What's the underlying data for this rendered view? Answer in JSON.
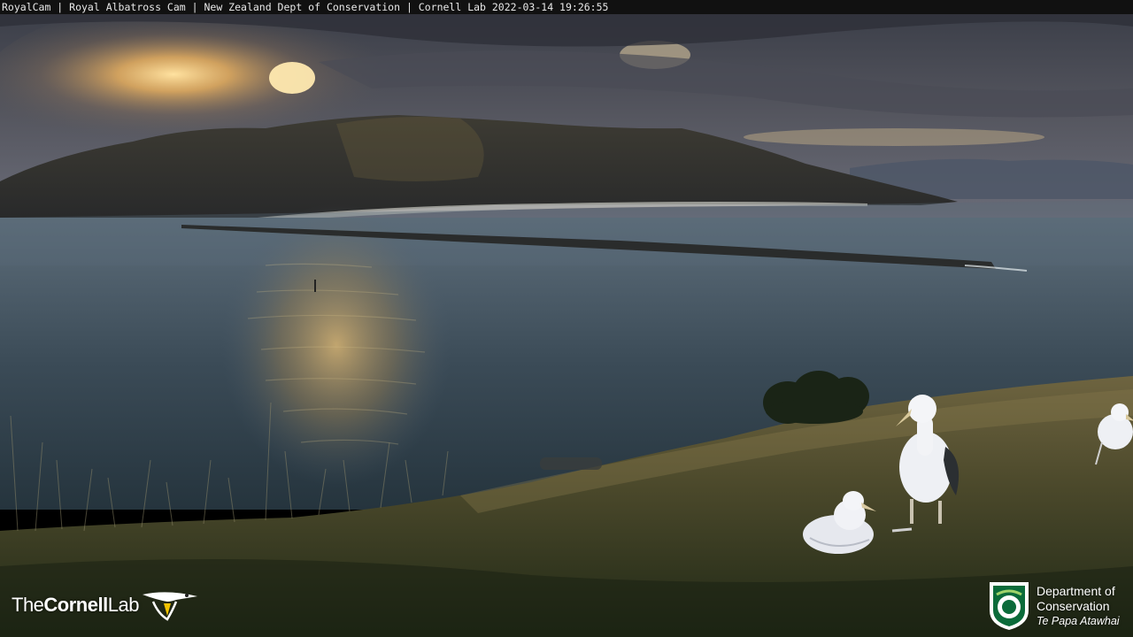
{
  "overlay": {
    "caption": "RoyalCam | Royal Albatross Cam | New Zealand Dept of Conservation | Cornell Lab 2022-03-14 19:26:55"
  },
  "logos": {
    "cornell": {
      "prefix": "The",
      "bold": "Cornell",
      "suffix": "Lab"
    },
    "doc": {
      "line1": "Department of",
      "line2": "Conservation",
      "line3": "Te Papa Atawhai",
      "shield_color": "#0b6b3a"
    }
  },
  "scene": {
    "subjects": [
      "albatross-chick",
      "adult-albatross",
      "adult-albatross"
    ],
    "colors": {
      "sky": "#4a4c57",
      "sun": "#ffd98a",
      "water": "#3b4a55",
      "grass": "#5a5230"
    }
  }
}
